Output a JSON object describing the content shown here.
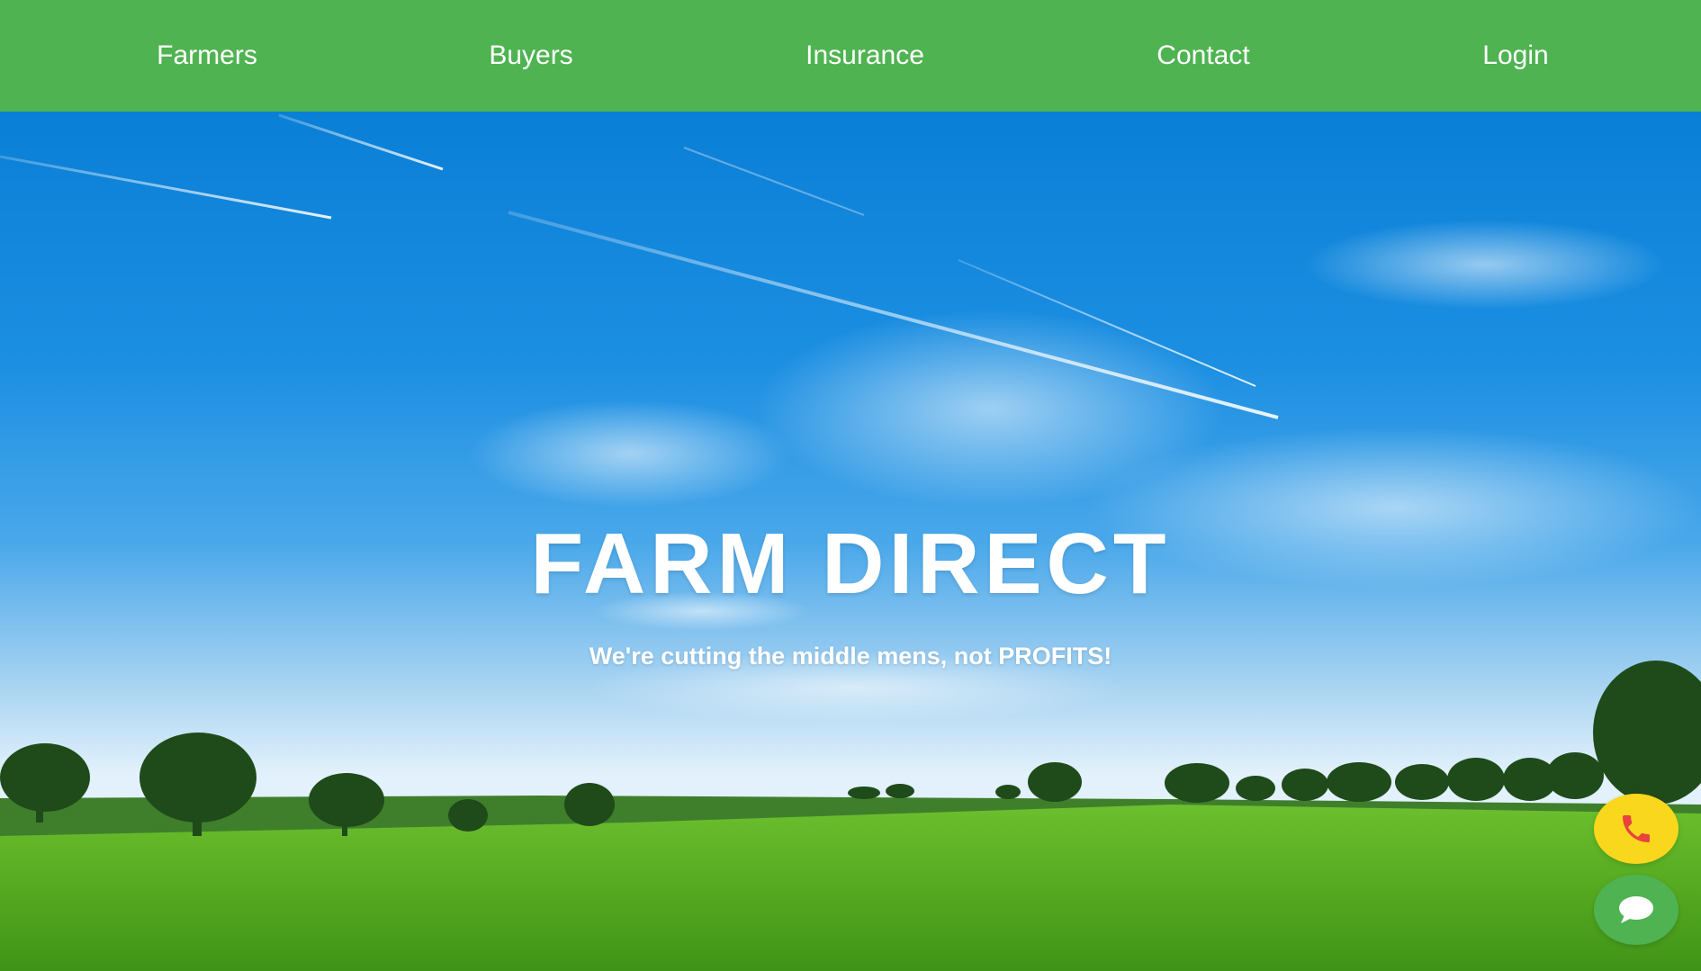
{
  "nav": {
    "items": [
      {
        "label": "Farmers"
      },
      {
        "label": "Buyers"
      },
      {
        "label": "Insurance"
      },
      {
        "label": "Contact"
      },
      {
        "label": "Login"
      }
    ]
  },
  "hero": {
    "title": "FARM DIRECT",
    "subtitle": "We're cutting the middle mens, not PROFITS!"
  },
  "floating_buttons": {
    "call": {
      "icon": "phone-icon",
      "color": "#f9d71c"
    },
    "chat": {
      "icon": "chat-bubble-icon",
      "color": "#4fb351"
    }
  },
  "colors": {
    "nav_background": "#4fb351",
    "sky": "#1a8ee0",
    "grass": "#5fb62a"
  }
}
